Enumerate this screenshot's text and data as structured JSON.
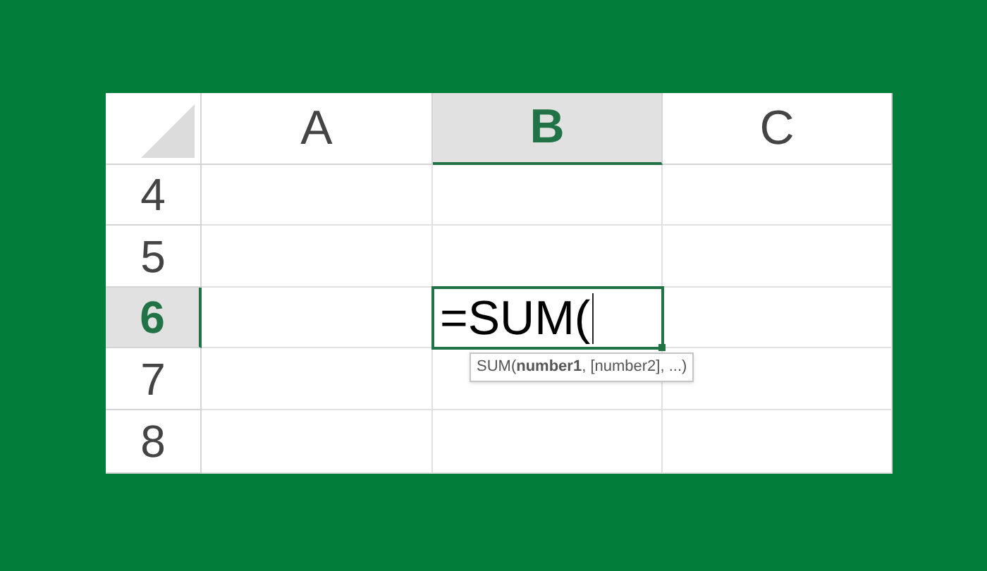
{
  "sheet": {
    "columns": [
      {
        "label": "A",
        "selected": false
      },
      {
        "label": "B",
        "selected": true
      },
      {
        "label": "C",
        "selected": false
      }
    ],
    "rows": [
      {
        "label": "4",
        "selected": false
      },
      {
        "label": "5",
        "selected": false
      },
      {
        "label": "6",
        "selected": true
      },
      {
        "label": "7",
        "selected": false
      },
      {
        "label": "8",
        "selected": false
      }
    ],
    "active_cell": {
      "value": "=SUM("
    },
    "tooltip": "SUM(**number1**, [number2], ...)"
  }
}
